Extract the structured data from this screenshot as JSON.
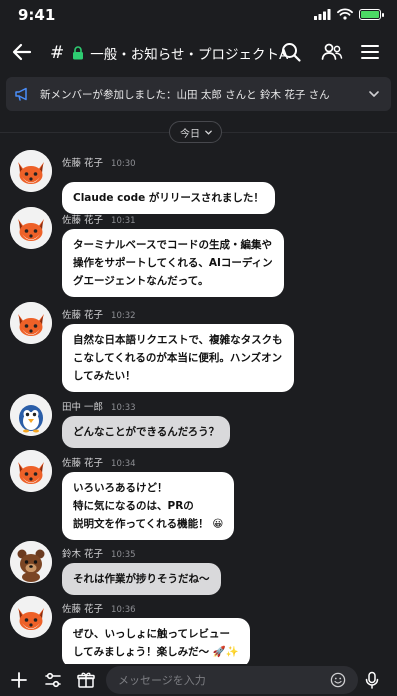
{
  "status_bar": {
    "time": "9:41"
  },
  "header": {
    "channel_hash": "#",
    "channel_name": "一般・お知らせ・プロジェクトA"
  },
  "announcement": {
    "text": "新メンバーが参加しました：山田 太郎 さんと 鈴木 花子 さん"
  },
  "date_divider": {
    "label": "今日"
  },
  "messages": [
    {
      "sender": "佐藤 花子",
      "time": "10:30",
      "avatar": "fox-avatar",
      "lines": [
        "Claude code がリリースされました！"
      ]
    },
    {
      "sender": "佐藤 花子",
      "time": "10:31",
      "avatar": "fox-avatar",
      "lines": [
        "ターミナルベースでコードの生成・編集や",
        "操作をサポートしてくれる、AIコーディン",
        "グエージェントなんだって。"
      ]
    },
    {
      "sender": "佐藤 花子",
      "time": "10:32",
      "avatar": "fox-avatar",
      "lines": [
        "自然な日本語リクエストで、複雑なタスクも",
        "こなしてくれるのが本当に便利。ハンズオン",
        "してみたい！"
      ]
    },
    {
      "sender": "田中 一郎",
      "time": "10:33",
      "avatar": "penguin-avatar",
      "lines": [
        "どんなことができるんだろう？"
      ]
    },
    {
      "sender": "佐藤 花子",
      "time": "10:34",
      "avatar": "fox-avatar",
      "lines": [
        "いろいろあるけど！",
        "特に気になるのは、PRの",
        "説明文を作ってくれる機能！ 😀"
      ]
    },
    {
      "sender": "鈴木 花子",
      "time": "10:35",
      "avatar": "bear-avatar",
      "lines": [
        "それは作業が捗りそうだね〜"
      ]
    },
    {
      "sender": "佐藤 花子",
      "time": "10:36",
      "avatar": "fox-avatar",
      "lines": [
        "ぜひ、いっしょに触ってレビュー",
        "してみましょう！楽しみだ〜 🚀✨"
      ]
    }
  ],
  "input": {
    "placeholder": "メッセージを入力"
  },
  "colors": {
    "background": "#1c1d20",
    "bubble": "#ffffff",
    "bubble_alt": "#d9d9db",
    "lock": "#2ecc71",
    "battery": "#4cd964"
  }
}
